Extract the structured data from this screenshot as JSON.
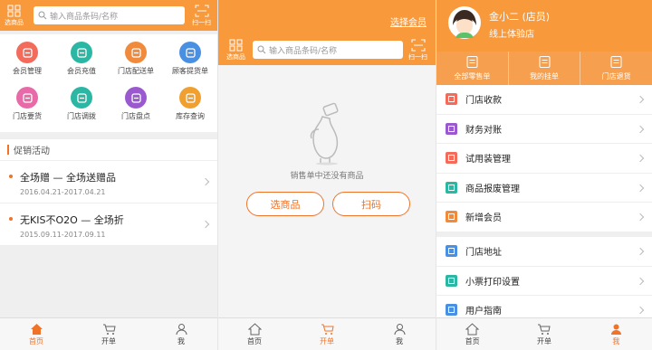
{
  "colors": {
    "accent": "#f89a3c",
    "active": "#f0732a"
  },
  "p1": {
    "select_goods": "选商品",
    "search_placeholder": "输入商品条码/名称",
    "scan": "扫一扫",
    "grid": [
      {
        "label": "会员管理",
        "color": "#f26b5b",
        "icon": "member-icon"
      },
      {
        "label": "会员充值",
        "color": "#2bb7a4",
        "icon": "card-icon"
      },
      {
        "label": "门店配送单",
        "color": "#f08a3c",
        "icon": "truck-icon"
      },
      {
        "label": "顾客提货单",
        "color": "#4a90e2",
        "icon": "receipt-icon"
      },
      {
        "label": "门店要货",
        "color": "#e86aa8",
        "icon": "box-icon"
      },
      {
        "label": "门店调拨",
        "color": "#2bb7a4",
        "icon": "transfer-icon"
      },
      {
        "label": "门店盘点",
        "color": "#9b59d0",
        "icon": "inventory-icon"
      },
      {
        "label": "库存查询",
        "color": "#f0a030",
        "icon": "search-stock-icon"
      }
    ],
    "promo_title": "促销活动",
    "promos": [
      {
        "title": "全场赠 — 全场送赠品",
        "date": "2016.04.21-2017.04.21"
      },
      {
        "title": "无KIS不O2O — 全场折",
        "date": "2015.09.11-2017.09.11"
      }
    ]
  },
  "p2": {
    "choose_member": "选择会员",
    "select_goods": "选商品",
    "search_placeholder": "输入商品条码/名称",
    "scan": "扫一扫",
    "empty_text": "销售单中还没有商品",
    "btn_select": "选商品",
    "btn_scan": "扫码"
  },
  "p3": {
    "user_name": "金小二 (店员)",
    "store": "线上体验店",
    "stats": [
      {
        "label": "全部零售单",
        "icon": "doc-icon"
      },
      {
        "label": "我的挂单",
        "icon": "calendar-icon"
      },
      {
        "label": "门店退货",
        "icon": "return-icon"
      }
    ],
    "menu1": [
      {
        "label": "门店收款",
        "color": "#f26b5b"
      },
      {
        "label": "财务对账",
        "color": "#9b59d0"
      },
      {
        "label": "试用装管理",
        "color": "#f26b5b"
      },
      {
        "label": "商品报废管理",
        "color": "#2bb7a4"
      },
      {
        "label": "新增会员",
        "color": "#f08a3c"
      }
    ],
    "menu2": [
      {
        "label": "门店地址",
        "color": "#4a90e2"
      },
      {
        "label": "小票打印设置",
        "color": "#2bb7a4"
      },
      {
        "label": "用户指南",
        "color": "#4a90e2"
      }
    ]
  },
  "tabs": {
    "home": "首页",
    "order": "开单",
    "me": "我"
  }
}
